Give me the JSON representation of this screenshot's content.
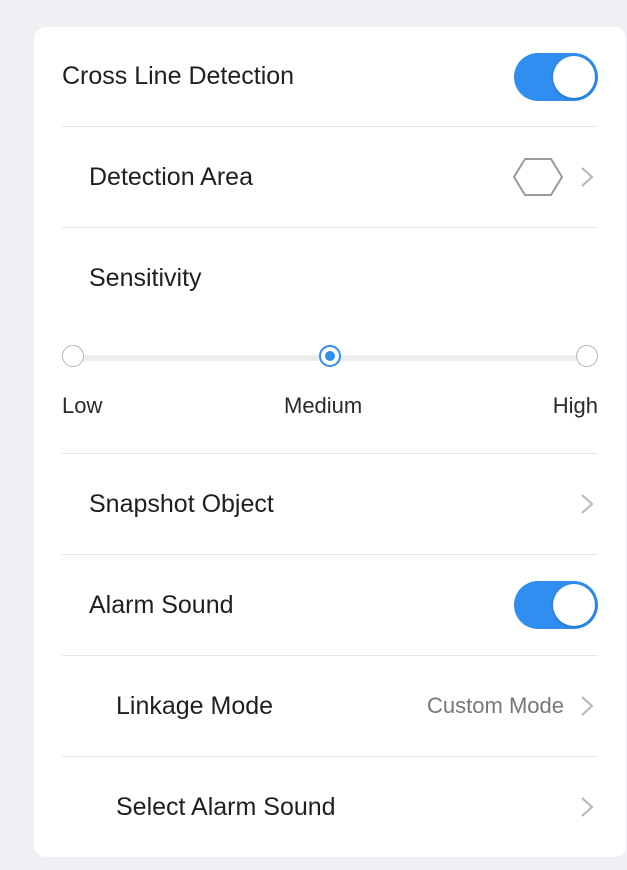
{
  "colors": {
    "accent": "#2f8ef0",
    "background": "#f1eff4",
    "card": "#ffffff",
    "divider": "#e6e6e6",
    "chevron": "#b5b5b5"
  },
  "cross_line": {
    "label": "Cross Line Detection",
    "enabled": true
  },
  "detection_area": {
    "label": "Detection Area",
    "icon": "hexagon-icon"
  },
  "sensitivity": {
    "label": "Sensitivity",
    "options": [
      "Low",
      "Medium",
      "High"
    ],
    "selected": "Medium"
  },
  "snapshot": {
    "label": "Snapshot Object"
  },
  "alarm_sound": {
    "label": "Alarm Sound",
    "enabled": true
  },
  "linkage_mode": {
    "label": "Linkage Mode",
    "value": "Custom Mode"
  },
  "select_alarm_sound": {
    "label": "Select Alarm Sound"
  }
}
